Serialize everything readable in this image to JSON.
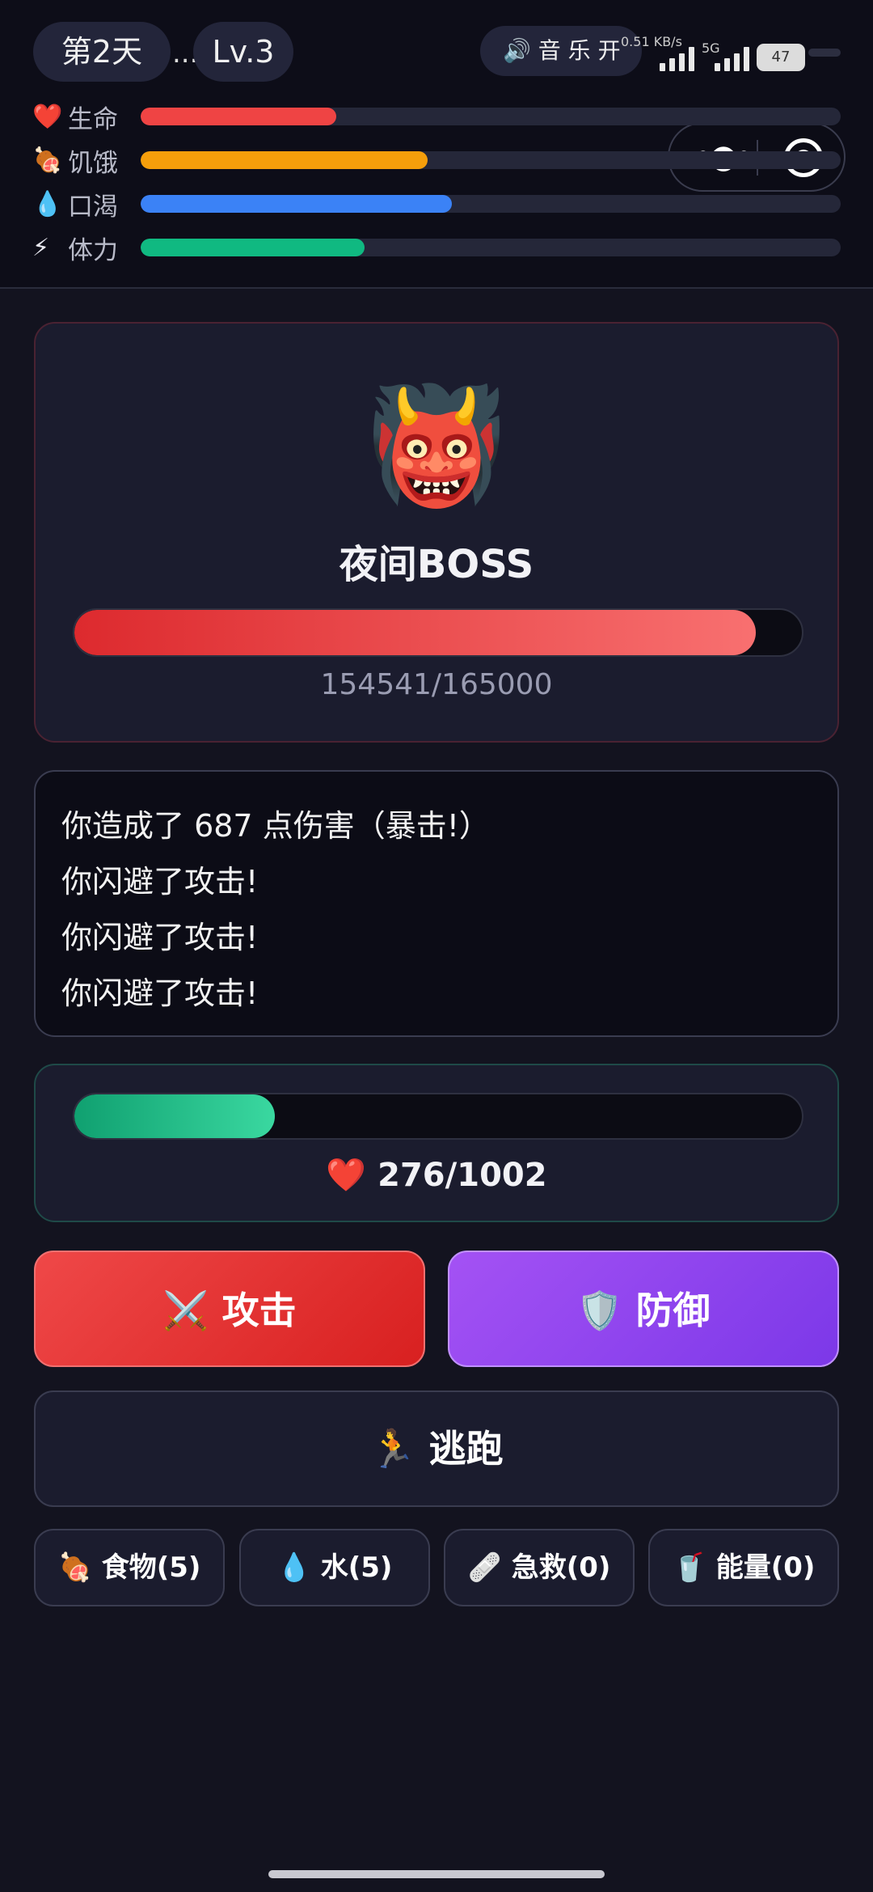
{
  "header": {
    "day": "第2天",
    "level": "Lv.3",
    "more": "...",
    "music_label": "🔊 音 乐 开",
    "net_speed": "0.51 KB/s",
    "net_gen": "5G",
    "battery": "47"
  },
  "stats": [
    {
      "icon": "❤️",
      "label": "生命",
      "value": 0.28,
      "color": "#ef4444"
    },
    {
      "icon": "🍖",
      "label": "饥饿",
      "value": 0.41,
      "color": "#f59e0b"
    },
    {
      "icon": "💧",
      "label": "口渴",
      "value": 0.445,
      "color": "#3b82f6"
    },
    {
      "icon": "⚡",
      "label": "体力",
      "value": 0.32,
      "color": "#10b981"
    }
  ],
  "boss": {
    "face": "👹",
    "name": "夜间BOSS",
    "hp_text": "154541/165000",
    "hp_fraction": 0.937
  },
  "log": [
    "你造成了 687 点伤害（暴击!）",
    "你闪避了攻击!",
    "你闪避了攻击!",
    "你闪避了攻击!"
  ],
  "player": {
    "hp_text": "❤️ 276/1002",
    "hp_fraction": 0.275
  },
  "actions": {
    "attack": "⚔️ 攻击",
    "defend": "🛡️ 防御",
    "flee": "🏃 逃跑"
  },
  "items": [
    "🍖 食物(5)",
    "💧 水(5)",
    "🩹 急救(0)",
    "🥤 能量(0)"
  ]
}
